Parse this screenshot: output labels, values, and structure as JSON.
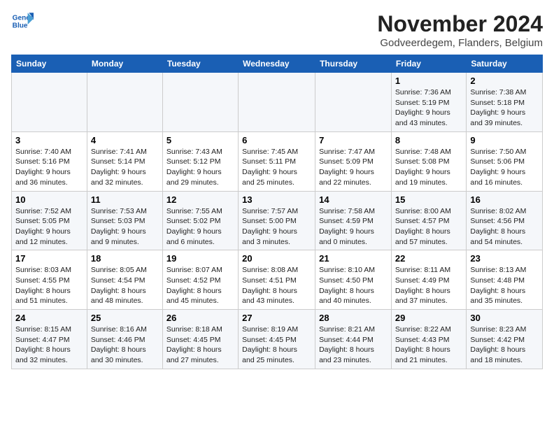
{
  "logo": {
    "line1": "General",
    "line2": "Blue"
  },
  "header": {
    "month_year": "November 2024",
    "location": "Godveerdegem, Flanders, Belgium"
  },
  "days_of_week": [
    "Sunday",
    "Monday",
    "Tuesday",
    "Wednesday",
    "Thursday",
    "Friday",
    "Saturday"
  ],
  "weeks": [
    [
      {
        "num": "",
        "info": ""
      },
      {
        "num": "",
        "info": ""
      },
      {
        "num": "",
        "info": ""
      },
      {
        "num": "",
        "info": ""
      },
      {
        "num": "",
        "info": ""
      },
      {
        "num": "1",
        "info": "Sunrise: 7:36 AM\nSunset: 5:19 PM\nDaylight: 9 hours and 43 minutes."
      },
      {
        "num": "2",
        "info": "Sunrise: 7:38 AM\nSunset: 5:18 PM\nDaylight: 9 hours and 39 minutes."
      }
    ],
    [
      {
        "num": "3",
        "info": "Sunrise: 7:40 AM\nSunset: 5:16 PM\nDaylight: 9 hours and 36 minutes."
      },
      {
        "num": "4",
        "info": "Sunrise: 7:41 AM\nSunset: 5:14 PM\nDaylight: 9 hours and 32 minutes."
      },
      {
        "num": "5",
        "info": "Sunrise: 7:43 AM\nSunset: 5:12 PM\nDaylight: 9 hours and 29 minutes."
      },
      {
        "num": "6",
        "info": "Sunrise: 7:45 AM\nSunset: 5:11 PM\nDaylight: 9 hours and 25 minutes."
      },
      {
        "num": "7",
        "info": "Sunrise: 7:47 AM\nSunset: 5:09 PM\nDaylight: 9 hours and 22 minutes."
      },
      {
        "num": "8",
        "info": "Sunrise: 7:48 AM\nSunset: 5:08 PM\nDaylight: 9 hours and 19 minutes."
      },
      {
        "num": "9",
        "info": "Sunrise: 7:50 AM\nSunset: 5:06 PM\nDaylight: 9 hours and 16 minutes."
      }
    ],
    [
      {
        "num": "10",
        "info": "Sunrise: 7:52 AM\nSunset: 5:05 PM\nDaylight: 9 hours and 12 minutes."
      },
      {
        "num": "11",
        "info": "Sunrise: 7:53 AM\nSunset: 5:03 PM\nDaylight: 9 hours and 9 minutes."
      },
      {
        "num": "12",
        "info": "Sunrise: 7:55 AM\nSunset: 5:02 PM\nDaylight: 9 hours and 6 minutes."
      },
      {
        "num": "13",
        "info": "Sunrise: 7:57 AM\nSunset: 5:00 PM\nDaylight: 9 hours and 3 minutes."
      },
      {
        "num": "14",
        "info": "Sunrise: 7:58 AM\nSunset: 4:59 PM\nDaylight: 9 hours and 0 minutes."
      },
      {
        "num": "15",
        "info": "Sunrise: 8:00 AM\nSunset: 4:57 PM\nDaylight: 8 hours and 57 minutes."
      },
      {
        "num": "16",
        "info": "Sunrise: 8:02 AM\nSunset: 4:56 PM\nDaylight: 8 hours and 54 minutes."
      }
    ],
    [
      {
        "num": "17",
        "info": "Sunrise: 8:03 AM\nSunset: 4:55 PM\nDaylight: 8 hours and 51 minutes."
      },
      {
        "num": "18",
        "info": "Sunrise: 8:05 AM\nSunset: 4:54 PM\nDaylight: 8 hours and 48 minutes."
      },
      {
        "num": "19",
        "info": "Sunrise: 8:07 AM\nSunset: 4:52 PM\nDaylight: 8 hours and 45 minutes."
      },
      {
        "num": "20",
        "info": "Sunrise: 8:08 AM\nSunset: 4:51 PM\nDaylight: 8 hours and 43 minutes."
      },
      {
        "num": "21",
        "info": "Sunrise: 8:10 AM\nSunset: 4:50 PM\nDaylight: 8 hours and 40 minutes."
      },
      {
        "num": "22",
        "info": "Sunrise: 8:11 AM\nSunset: 4:49 PM\nDaylight: 8 hours and 37 minutes."
      },
      {
        "num": "23",
        "info": "Sunrise: 8:13 AM\nSunset: 4:48 PM\nDaylight: 8 hours and 35 minutes."
      }
    ],
    [
      {
        "num": "24",
        "info": "Sunrise: 8:15 AM\nSunset: 4:47 PM\nDaylight: 8 hours and 32 minutes."
      },
      {
        "num": "25",
        "info": "Sunrise: 8:16 AM\nSunset: 4:46 PM\nDaylight: 8 hours and 30 minutes."
      },
      {
        "num": "26",
        "info": "Sunrise: 8:18 AM\nSunset: 4:45 PM\nDaylight: 8 hours and 27 minutes."
      },
      {
        "num": "27",
        "info": "Sunrise: 8:19 AM\nSunset: 4:45 PM\nDaylight: 8 hours and 25 minutes."
      },
      {
        "num": "28",
        "info": "Sunrise: 8:21 AM\nSunset: 4:44 PM\nDaylight: 8 hours and 23 minutes."
      },
      {
        "num": "29",
        "info": "Sunrise: 8:22 AM\nSunset: 4:43 PM\nDaylight: 8 hours and 21 minutes."
      },
      {
        "num": "30",
        "info": "Sunrise: 8:23 AM\nSunset: 4:42 PM\nDaylight: 8 hours and 18 minutes."
      }
    ]
  ]
}
